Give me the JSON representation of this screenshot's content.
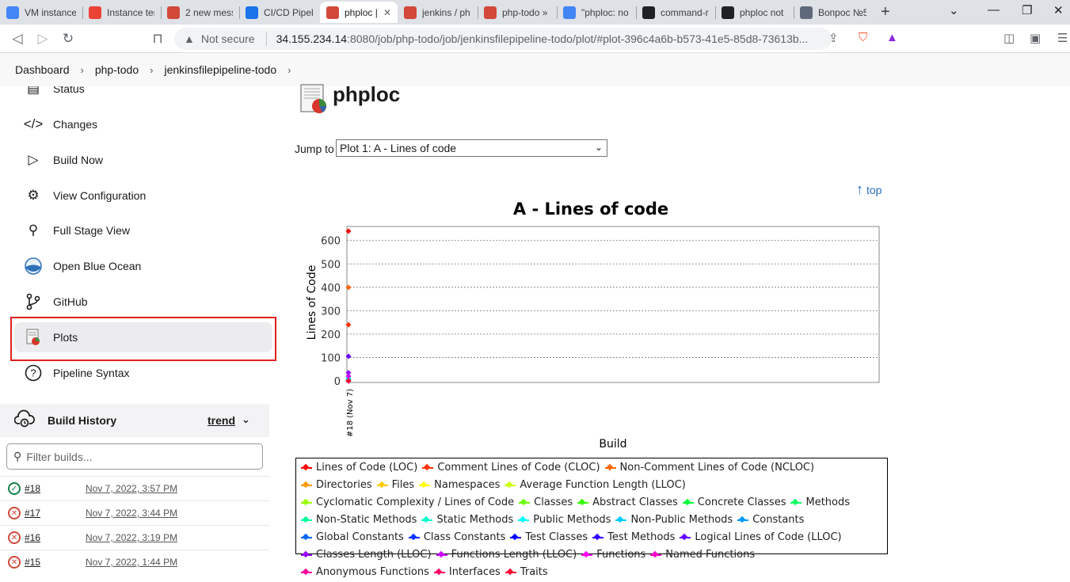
{
  "browser": {
    "tabs": [
      {
        "title": "VM instance",
        "icon": "gcp-icon",
        "color": "#4285f4",
        "active": false
      },
      {
        "title": "Instance ten",
        "icon": "google-cloud-icon",
        "color": "#ea4335",
        "active": false
      },
      {
        "title": "2 new mess",
        "icon": "jenkins-icon",
        "color": "#d24939",
        "active": false
      },
      {
        "title": "CI/CD Pipel",
        "icon": "gear-icon",
        "color": "#1a73e8",
        "active": false
      },
      {
        "title": "phploc |",
        "icon": "jenkins-icon",
        "color": "#d24939",
        "active": true
      },
      {
        "title": "jenkins / ph",
        "icon": "jenkins-icon",
        "color": "#d24939",
        "active": false
      },
      {
        "title": "php-todo »",
        "icon": "jenkins-icon",
        "color": "#d24939",
        "active": false
      },
      {
        "title": "\"phploc: no",
        "icon": "google-icon",
        "color": "#4285f4",
        "active": false
      },
      {
        "title": "command-r",
        "icon": "terminal-icon",
        "color": "#202124",
        "active": false
      },
      {
        "title": "phploc not",
        "icon": "github-icon",
        "color": "#202124",
        "active": false
      },
      {
        "title": "Вопрос №5",
        "icon": "habr-icon",
        "color": "#5e6a7a",
        "active": false
      }
    ],
    "url_warning": "Not secure",
    "url_host": "34.155.234.14",
    "url_path": ":8080/job/php-todo/job/jenkinsfilepipeline-todo/plot/#plot-396c4a6b-b573-41e5-85d8-73613b..."
  },
  "breadcrumb": [
    "Dashboard",
    "php-todo",
    "jenkinsfilepipeline-todo"
  ],
  "sidebar": {
    "items": [
      {
        "label": "Status",
        "icon": "document-icon"
      },
      {
        "label": "Changes",
        "icon": "code-icon"
      },
      {
        "label": "Build Now",
        "icon": "play-icon"
      },
      {
        "label": "View Configuration",
        "icon": "gear-icon"
      },
      {
        "label": "Full Stage View",
        "icon": "search-icon"
      },
      {
        "label": "Open Blue Ocean",
        "icon": "blue-ocean-icon"
      },
      {
        "label": "GitHub",
        "icon": "branch-icon"
      },
      {
        "label": "Plots",
        "icon": "plot-icon",
        "selected": true
      },
      {
        "label": "Pipeline Syntax",
        "icon": "help-icon"
      }
    ]
  },
  "build_history": {
    "title": "Build History",
    "trend": "trend",
    "filter_placeholder": "Filter builds...",
    "builds": [
      {
        "number": "#18",
        "date": "Nov 7, 2022, 3:57 PM",
        "status": "success"
      },
      {
        "number": "#17",
        "date": "Nov 7, 2022, 3:44 PM",
        "status": "failed"
      },
      {
        "number": "#16",
        "date": "Nov 7, 2022, 3:19 PM",
        "status": "failed"
      },
      {
        "number": "#15",
        "date": "Nov 7, 2022, 1:44 PM",
        "status": "failed"
      }
    ]
  },
  "main": {
    "title": "phploc",
    "jump_label": "Jump to",
    "jump_selected": "Plot 1: A - Lines of code",
    "top_link": "top"
  },
  "chart_data": {
    "type": "line",
    "title": "A - Lines of code",
    "xlabel": "Build",
    "ylabel": "Lines of Code",
    "x": [
      "#18 (Nov 7)"
    ],
    "ylim": [
      0,
      660
    ],
    "yticks": [
      0,
      100,
      200,
      300,
      400,
      500,
      600
    ],
    "grid": true,
    "legend_position": "bottom",
    "series": [
      {
        "name": "Lines of Code (LOC)",
        "color": "#ff0000",
        "values": [
          640
        ]
      },
      {
        "name": "Comment Lines of Code (CLOC)",
        "color": "#ff3300",
        "values": [
          240
        ]
      },
      {
        "name": "Non-Comment Lines of Code (NCLOC)",
        "color": "#ff6600",
        "values": [
          400
        ]
      },
      {
        "name": "Directories",
        "color": "#ff9900",
        "values": [
          4
        ]
      },
      {
        "name": "Files",
        "color": "#ffcc00",
        "values": [
          4
        ]
      },
      {
        "name": "Namespaces",
        "color": "#ffff00",
        "values": [
          0
        ]
      },
      {
        "name": "Average Function Length (LLOC)",
        "color": "#ccff00",
        "values": [
          3
        ]
      },
      {
        "name": "Cyclomatic Complexity / Lines of Code",
        "color": "#99ff00",
        "values": [
          0
        ]
      },
      {
        "name": "Classes",
        "color": "#66ff00",
        "values": [
          4
        ]
      },
      {
        "name": "Abstract Classes",
        "color": "#33ff00",
        "values": [
          0
        ]
      },
      {
        "name": "Concrete Classes",
        "color": "#00ff33",
        "values": [
          4
        ]
      },
      {
        "name": "Methods",
        "color": "#00ff66",
        "values": [
          10
        ]
      },
      {
        "name": "Non-Static Methods",
        "color": "#00ff99",
        "values": [
          10
        ]
      },
      {
        "name": "Static Methods",
        "color": "#00ffcc",
        "values": [
          0
        ]
      },
      {
        "name": "Public Methods",
        "color": "#00ffff",
        "values": [
          10
        ]
      },
      {
        "name": "Non-Public Methods",
        "color": "#00ccff",
        "values": [
          0
        ]
      },
      {
        "name": "Constants",
        "color": "#0099ff",
        "values": [
          0
        ]
      },
      {
        "name": "Global Constants",
        "color": "#0066ff",
        "values": [
          0
        ]
      },
      {
        "name": "Class Constants",
        "color": "#0033ff",
        "values": [
          0
        ]
      },
      {
        "name": "Test Classes",
        "color": "#0000ff",
        "values": [
          0
        ]
      },
      {
        "name": "Test Methods",
        "color": "#3300ff",
        "values": [
          0
        ]
      },
      {
        "name": "Logical Lines of Code (LLOC)",
        "color": "#6600ff",
        "values": [
          105
        ]
      },
      {
        "name": "Classes Length (LLOC)",
        "color": "#9900ff",
        "values": [
          35
        ]
      },
      {
        "name": "Functions Length (LLOC)",
        "color": "#cc00ff",
        "values": [
          20
        ]
      },
      {
        "name": "Functions",
        "color": "#ff00ff",
        "values": [
          0
        ]
      },
      {
        "name": "Named Functions",
        "color": "#ff00cc",
        "values": [
          0
        ]
      },
      {
        "name": "Anonymous Functions",
        "color": "#ff0099",
        "values": [
          0
        ]
      },
      {
        "name": "Interfaces",
        "color": "#ff0066",
        "values": [
          0
        ]
      },
      {
        "name": "Traits",
        "color": "#ff0033",
        "values": [
          0
        ]
      }
    ]
  }
}
